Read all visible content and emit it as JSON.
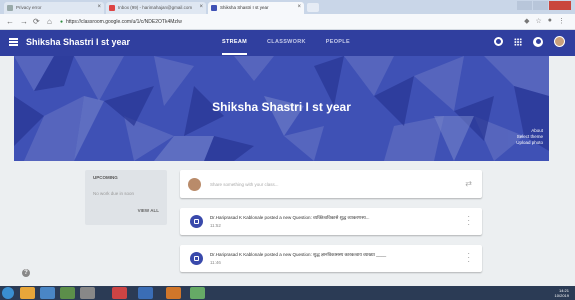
{
  "browser": {
    "tabs": [
      {
        "label": "Privacy error"
      },
      {
        "label": "Inbox (99) - harimahajan@gmail.com"
      },
      {
        "label": "Shiksha Shastri I st year"
      }
    ],
    "url": "https://classroom.google.com/u/1/c/NDE2OTk4MzIw"
  },
  "appbar": {
    "title": "Shiksha Shastri I st year",
    "tabs": [
      "STREAM",
      "CLASSWORK",
      "PEOPLE"
    ]
  },
  "banner": {
    "title": "Shiksha Shastri I st year",
    "links": [
      "About",
      "Select theme",
      "Upload photo"
    ]
  },
  "upcoming": {
    "title": "UPCOMING",
    "empty": "No work due in soon",
    "view_all": "VIEW ALL"
  },
  "share": {
    "placeholder": "Share something with your class..."
  },
  "posts": [
    {
      "text": "Dr.Hariprasad K Kablonale posted a new Question: व्यक्तित्वविकासे शुद्ध व्याकरणस्य...",
      "time": "11:52"
    },
    {
      "text": "Dr.Hariprasad K Kablonale posted a new Question: शुद्ध ज्ञानविकासस्य कारकत्वाय व्याख्या ____",
      "time": "11:46"
    }
  ],
  "taskbar": {
    "time": "14:21",
    "date": "10/2019"
  },
  "colors": {
    "primary": "#303f9f",
    "banner": "#3f51b5",
    "background": "#eceff1"
  }
}
